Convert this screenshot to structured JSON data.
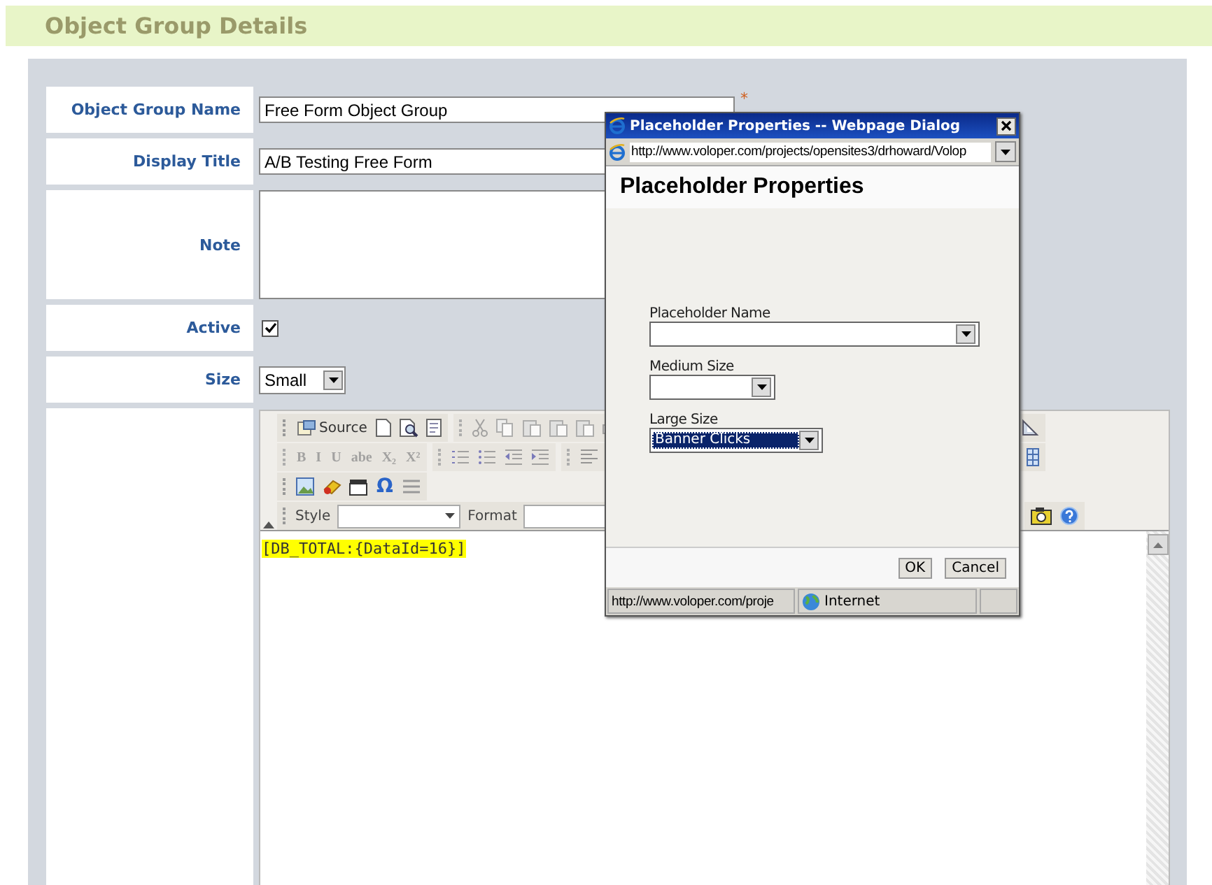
{
  "header": {
    "title": "Object Group Details"
  },
  "form": {
    "fields": [
      {
        "kind": "text",
        "label": "Object Group Name",
        "value": "Free Form Object Group",
        "required_mark": "*"
      },
      {
        "kind": "text",
        "label": "Display Title",
        "value": "A/B Testing Free Form"
      },
      {
        "kind": "textarea",
        "label": "Note"
      },
      {
        "kind": "checkbox",
        "label": "Active",
        "checked": true
      },
      {
        "kind": "select",
        "label": "Size",
        "value": "Small"
      },
      {
        "kind": "editor"
      }
    ]
  },
  "editor": {
    "source_label": "Source",
    "format_buttons": [
      "B",
      "I",
      "U",
      "abe",
      "X₂",
      "X²"
    ],
    "special_char": "Ω",
    "style_label": "Style",
    "format_label": "Format",
    "content": "[DB_TOTAL:{DataId=16}]"
  },
  "dialog": {
    "title": "Placeholder Properties -- Webpage Dialog",
    "url": "http://www.voloper.com/projects/opensites3/drhoward/Volop",
    "heading": "Placeholder Properties",
    "fields": [
      {
        "label": "Placeholder Name",
        "focused": false
      },
      {
        "label": "Medium Size",
        "focused": false
      },
      {
        "label": "Large Size",
        "value": "Banner Clicks",
        "focused": true
      }
    ],
    "buttons": [
      "OK",
      "Cancel"
    ],
    "status": {
      "url": "http://www.voloper.com/proje",
      "zone": "Internet"
    }
  }
}
